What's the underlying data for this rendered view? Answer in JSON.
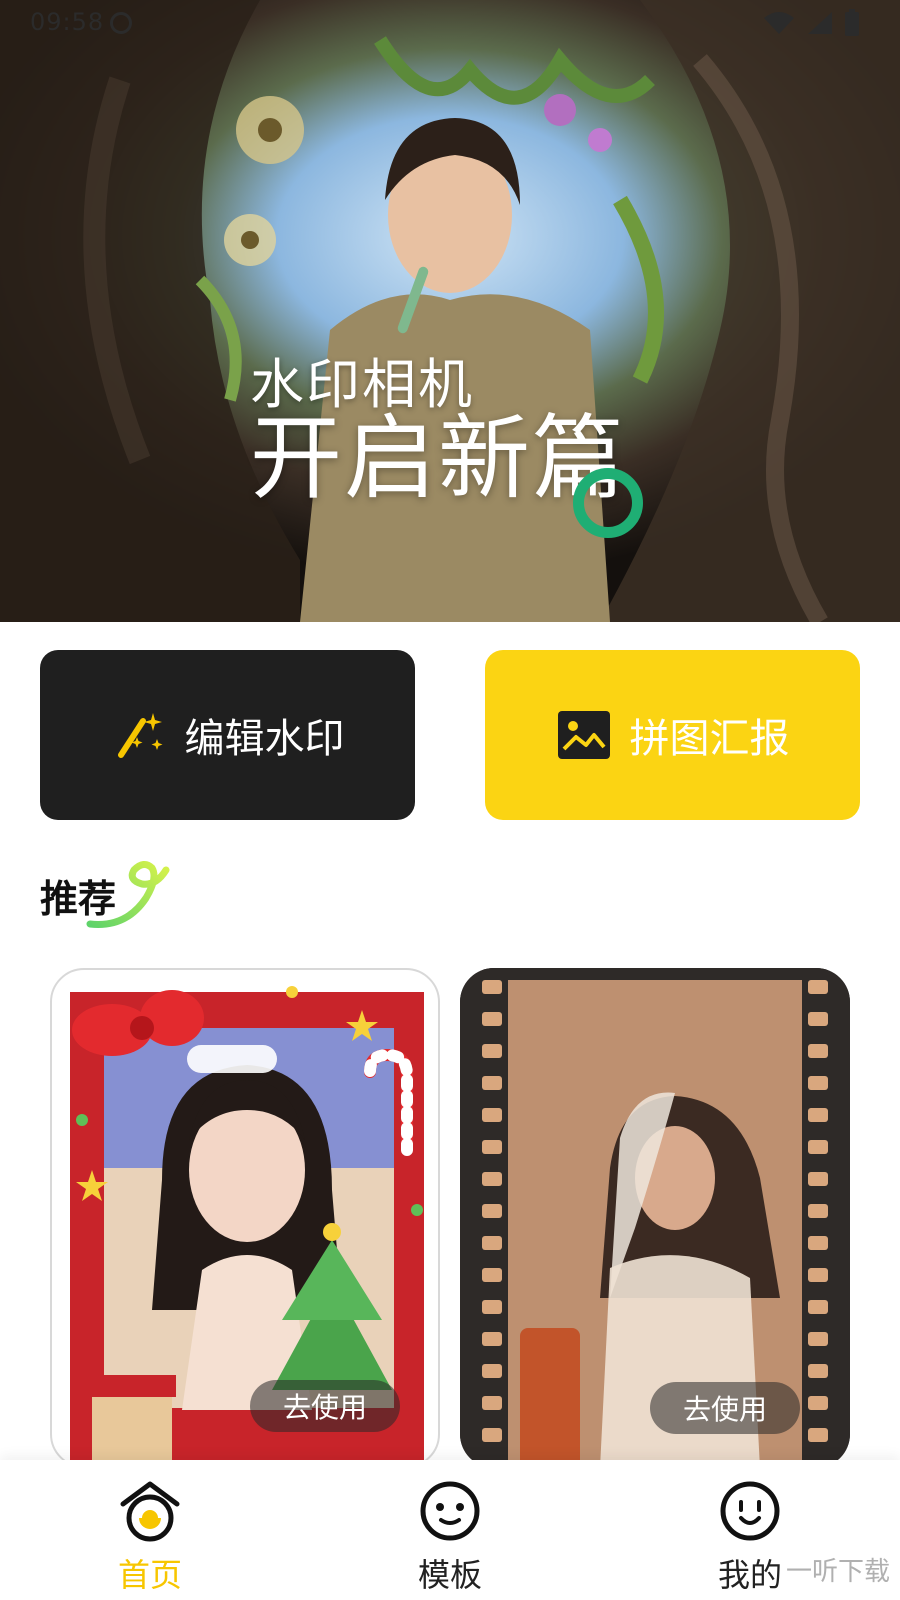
{
  "status_bar": {
    "time": "09:58"
  },
  "hero": {
    "title_small": "水印相机",
    "title_large": "开启新篇"
  },
  "actions": {
    "edit_watermark": {
      "label": "编辑水印",
      "icon": "magic-wand-icon"
    },
    "collage_report": {
      "label": "拼图汇报",
      "icon": "image-icon"
    }
  },
  "recommend": {
    "title": "推荐",
    "cards": [
      {
        "button_label": "去使用",
        "theme": "christmas-frame"
      },
      {
        "button_label": "去使用",
        "theme": "film-strip"
      }
    ]
  },
  "nav": {
    "items": [
      {
        "label": "首页",
        "icon": "home-icon",
        "active": true
      },
      {
        "label": "模板",
        "icon": "template-face-icon",
        "active": false
      },
      {
        "label": "我的",
        "icon": "profile-face-icon",
        "active": false
      }
    ]
  },
  "watermark": "一听下载",
  "colors": {
    "accent_yellow": "#fbd413",
    "dark_button": "#1f1f1f",
    "logo_green": "#1fae74"
  }
}
